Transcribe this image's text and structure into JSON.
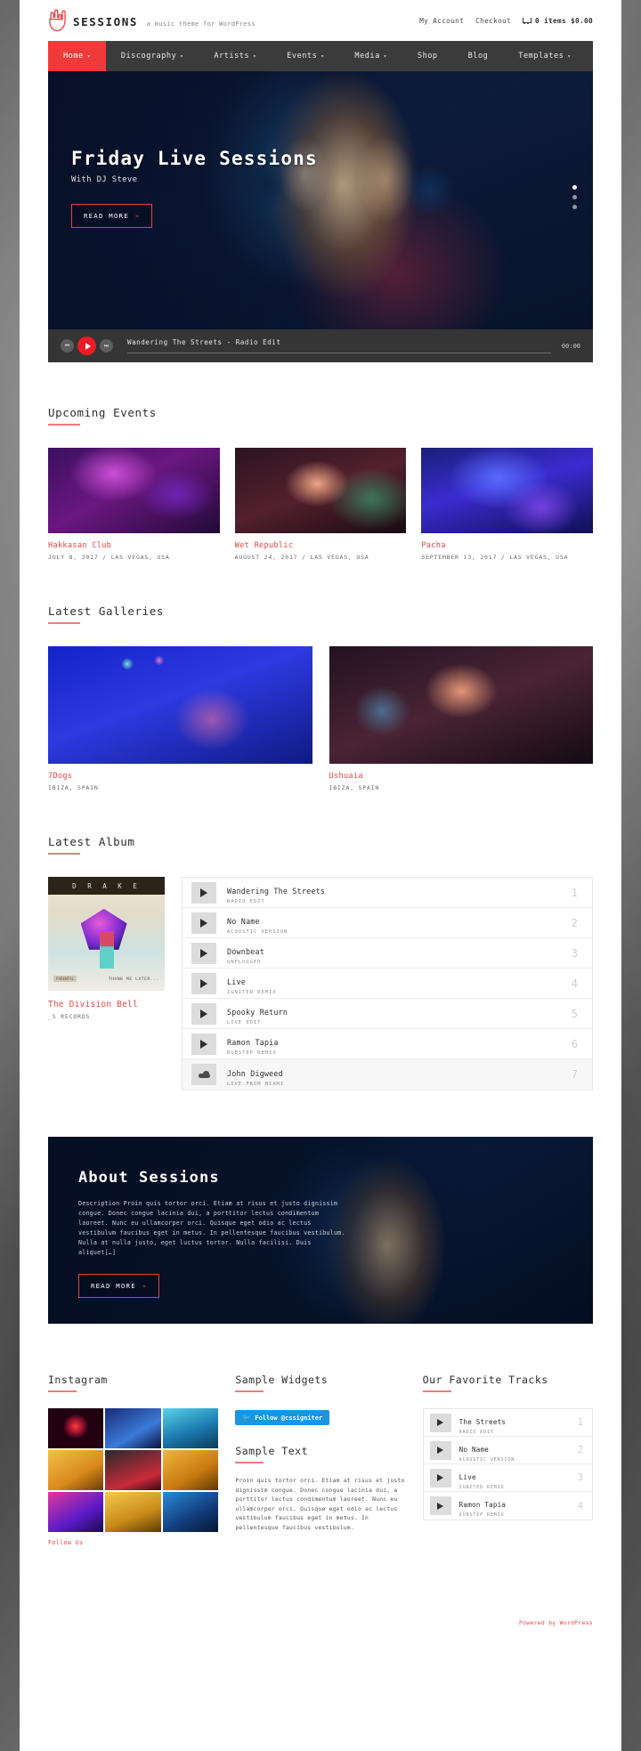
{
  "header": {
    "brand": "SESSIONS",
    "tagline": "a music theme for WordPress",
    "logo_icon": "rock-hand-icon",
    "links": [
      {
        "label": "My Account"
      },
      {
        "label": "Checkout"
      }
    ],
    "cart_icon": "cart-icon",
    "cart_items": "0 items",
    "cart_total": "$0.00"
  },
  "menu": {
    "items": [
      {
        "label": "Home",
        "caret": "▾",
        "active": true
      },
      {
        "label": "Discography",
        "caret": "▾",
        "active": false
      },
      {
        "label": "Artists",
        "caret": "▾",
        "active": false
      },
      {
        "label": "Events",
        "caret": "▾",
        "active": false
      },
      {
        "label": "Media",
        "caret": "▾",
        "active": false
      },
      {
        "label": "Shop",
        "caret": "",
        "active": false
      },
      {
        "label": "Blog",
        "caret": "",
        "active": false
      },
      {
        "label": "Templates",
        "caret": "▾",
        "active": false
      }
    ]
  },
  "hero": {
    "title": "Friday Live Sessions",
    "subtitle": "With DJ Steve",
    "button": "READ MORE",
    "button_arrow": "»"
  },
  "player": {
    "prev_icon": "skip-back-icon",
    "play_icon": "play-icon",
    "next_icon": "skip-forward-icon",
    "track_title": "Wandering The Streets - Radio Edit",
    "time": "00:00"
  },
  "events": {
    "title": "Upcoming Events",
    "items": [
      {
        "name": "Hakkasan Club",
        "meta": "JULY 8, 2017 / LAS VEGAS, USA"
      },
      {
        "name": "Wet Republic",
        "meta": "AUGUST 24, 2017 / LAS VEGAS, USA"
      },
      {
        "name": "Pacha",
        "meta": "SEPTEMBER 13, 2017 / LAS VEGAS, USA"
      }
    ]
  },
  "galleries": {
    "title": "Latest Galleries",
    "items": [
      {
        "name": "7Dogs",
        "meta": "IBIZA, SPAIN"
      },
      {
        "name": "Ushuaia",
        "meta": "IBIZA, SPAIN"
      }
    ]
  },
  "album": {
    "title": "Latest Album",
    "cover_artist": "D R A K E",
    "cover_caption": "THANK ME LATER...",
    "cover_label": "PARENTAL",
    "name": "The Division Bell",
    "label": "_S RECORDS",
    "tracks": [
      {
        "name": "Wandering The Streets",
        "sub": "RADIO EDIT",
        "num": "1",
        "icon": "play-icon"
      },
      {
        "name": "No Name",
        "sub": "ACOUSTIC VERSION",
        "num": "2",
        "icon": "play-icon"
      },
      {
        "name": "Downbeat",
        "sub": "UNPLUGGED",
        "num": "3",
        "icon": "play-icon"
      },
      {
        "name": "Live",
        "sub": "IGNITED REMIX",
        "num": "4",
        "icon": "play-icon"
      },
      {
        "name": "Spooky Return",
        "sub": "LIVE EDIT",
        "num": "5",
        "icon": "play-icon"
      },
      {
        "name": "Ramon Tapia",
        "sub": "DUBSTEP REMIX",
        "num": "6",
        "icon": "play-icon"
      },
      {
        "name": "John Digweed",
        "sub": "LIVE FROM MIAMI",
        "num": "7",
        "icon": "soundcloud-icon"
      }
    ]
  },
  "about": {
    "title": "About Sessions",
    "text": "Description Proin quis tortor orci. Etiam at risus et justo dignissim congue. Donec congue lacinia dui, a porttitor lectus condimentum laoreet. Nunc eu ullamcorper orci. Quisque eget odio ac lectus vestibulum faucibus eget in metus. In pellentesque faucibus vestibulum. Nulla at nulla justo, eget luctus tortor. Nulla facilisi. Duis aliquet[…]",
    "button": "READ MORE",
    "button_arrow": "»"
  },
  "widgets": {
    "instagram": {
      "title": "Instagram",
      "follow_label": "Follow Us"
    },
    "sample": {
      "title": "Sample Widgets",
      "twitter_button": "Follow @cssigniter",
      "twitter_icon": "twitter-bird-icon",
      "sub_title": "Sample Text",
      "body": "Proin quis tortor orci. Etiam at risus et justo dignissim congue. Donec congue lacinia dui, a porttitor lectus condimentum laoreet. Nunc eu ullamcorper orci. Quisque eget odio ac lectus vestibulum faucibus eget in metus. In pellentesque faucibus vestibulum."
    },
    "favorites": {
      "title": "Our Favorite Tracks",
      "tracks": [
        {
          "name": "The Streets",
          "sub": "RADIO EDIT",
          "num": "1",
          "icon": "play-icon"
        },
        {
          "name": "No Name",
          "sub": "ACOUSTIC VERSION",
          "num": "2",
          "icon": "play-icon"
        },
        {
          "name": "Live",
          "sub": "IGNITED REMIX",
          "num": "3",
          "icon": "play-icon"
        },
        {
          "name": "Ramon Tapia",
          "sub": "DUBSTEP REMIX",
          "num": "4",
          "icon": "play-icon"
        }
      ]
    }
  },
  "footer": {
    "credit": "Powered by WordPress",
    "left": ""
  },
  "colors": {
    "accent": "#ef4444",
    "menu_active": "#f03a3a",
    "underline": "#f37a7a",
    "twitter": "#1b95e0"
  }
}
